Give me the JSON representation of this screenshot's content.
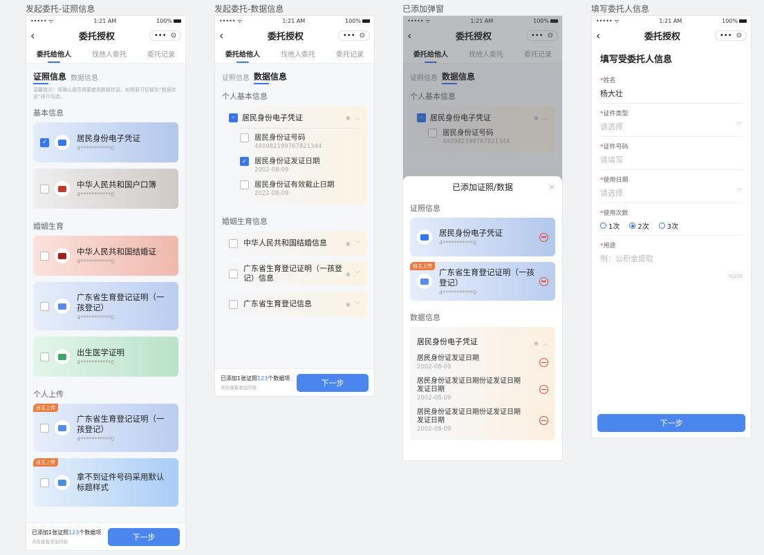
{
  "status": {
    "carrier": "••••• ᯤ",
    "time": "1:21 AM",
    "battery": "100%"
  },
  "nav": {
    "back": "‹",
    "title": "委托授权",
    "more": "•••",
    "record": "⊙"
  },
  "tabs": [
    "委托给他人",
    "找他人委托",
    "委托记录"
  ],
  "next": "下一步",
  "bottom": {
    "prefix": "已添加1张证照",
    "count": "123",
    "suffix": "个数据项",
    "hint": "点击查看添加内容"
  },
  "screen1": {
    "caption": "发起委托-证照信息",
    "sub": [
      "证照信息",
      "数据信息"
    ],
    "hint": "温馨提示：请确认是否需要使用数据信息。如需要可切换到“数据信息”进行勾选。",
    "sections": [
      {
        "title": "基本信息",
        "cards": [
          {
            "name": "居民身份电子凭证",
            "num": "4***********0",
            "checked": true,
            "style": "blue",
            "icon": "id-card-icon",
            "iconColor": "#3477f0"
          },
          {
            "name": "中华人民共和国户口簿",
            "num": "4***********0",
            "checked": false,
            "style": "grey",
            "icon": "household-register-icon",
            "iconColor": "#c0392b"
          }
        ]
      },
      {
        "title": "婚姻生育",
        "cards": [
          {
            "name": "中华人民共和国结婚证",
            "num": "4***********0",
            "checked": false,
            "style": "red",
            "icon": "marriage-certificate-icon",
            "iconColor": "#a61c1c"
          },
          {
            "name": "广东省生育登记证明（一孩登记）",
            "num": "4***********0",
            "checked": false,
            "style": "lblue",
            "icon": "birth-registration-icon",
            "iconColor": "#5b8be8"
          },
          {
            "name": "出生医学证明",
            "num": "4***********0",
            "checked": false,
            "style": "green",
            "icon": "birth-certificate-icon",
            "iconColor": "#3fa36a"
          }
        ]
      },
      {
        "title": "个人上传",
        "cards": [
          {
            "name": "广东省生育登记证明（一孩登记）",
            "num": "4***********0",
            "checked": false,
            "style": "lblue",
            "icon": "birth-registration-icon",
            "iconColor": "#5b8be8",
            "tag": "自主上传"
          },
          {
            "name": "拿不到证件号码采用默认标题样式",
            "num": "",
            "checked": false,
            "style": "sky",
            "icon": "default-card-icon",
            "iconColor": "#4a90e2",
            "tag": "自主上传"
          }
        ]
      }
    ]
  },
  "screen2": {
    "caption": "发起委托-数据信息",
    "sub": [
      "证照信息",
      "数据信息"
    ],
    "section1": "个人基本信息",
    "group": {
      "name": "居民身份电子凭证",
      "items": [
        {
          "name": "居民身份证号码",
          "value": "440982199767821344",
          "checked": false
        },
        {
          "name": "居民身份证发证日期",
          "value": "2002-08-09",
          "checked": true
        },
        {
          "name": "居民身份证有效截止日期",
          "value": "2022-08-09",
          "checked": false
        }
      ]
    },
    "section2": "婚姻生育信息",
    "singles": [
      "中华人民共和国结婚信息",
      "广东省生育登记证明（一孩登记）信息",
      "广东省生育登记信息"
    ]
  },
  "screen3": {
    "caption": "已添加弹窗",
    "modalTitle": "已添加证照/数据",
    "close": "×",
    "certSection": "证照信息",
    "certs": [
      {
        "name": "居民身份电子凭证",
        "num": "4***********0",
        "style": "blue",
        "icon": "id-card-icon",
        "iconColor": "#3477f0"
      },
      {
        "name": "广东省生育登记证明（一孩登记）",
        "num": "4***********0",
        "style": "lblue",
        "icon": "birth-registration-icon",
        "iconColor": "#5b8be8",
        "tag": "自主上传"
      }
    ],
    "dataSection": "数据信息",
    "dataGroup": "居民身份电子凭证",
    "dataItems": [
      {
        "name": "居民身份证发证日期",
        "value": "2002-08-09"
      },
      {
        "name": "居民身份证发证日期份证发证日期发证日期",
        "value": "2002-08-09"
      },
      {
        "name": "居民身份证发证日期份证发证日期发证日期",
        "value": "2002-08-09"
      }
    ]
  },
  "screen4": {
    "caption": "填写委托人信息",
    "heading": "填写受委托人信息",
    "fields": [
      {
        "label": "姓名",
        "value": "杨大壮",
        "placeholder": false,
        "dropdown": false
      },
      {
        "label": "证件类型",
        "value": "请选择",
        "placeholder": true,
        "dropdown": true
      },
      {
        "label": "证件号码",
        "value": "请填写",
        "placeholder": true,
        "dropdown": false
      },
      {
        "label": "使用日期",
        "value": "请选择",
        "placeholder": true,
        "dropdown": true
      }
    ],
    "countLabel": "使用次数",
    "counts": [
      {
        "label": "1次",
        "selected": false
      },
      {
        "label": "2次",
        "selected": true
      },
      {
        "label": "3次",
        "selected": false
      }
    ],
    "purposeLabel": "用途",
    "purposePlaceholder": "例：公积金提取",
    "charCount": "0/200"
  }
}
